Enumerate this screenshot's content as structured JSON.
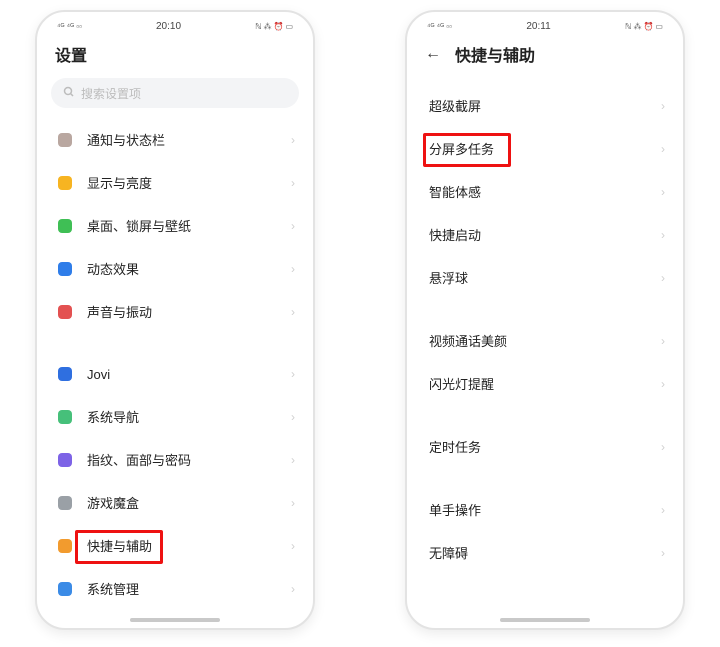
{
  "left": {
    "status": {
      "time": "20:10"
    },
    "title": "设置",
    "search_placeholder": "搜索设置项",
    "groups": [
      [
        {
          "icon": "bell-icon",
          "color": "#b9a7a0",
          "label": "通知与状态栏"
        },
        {
          "icon": "sun-icon",
          "color": "#f7b421",
          "label": "显示与亮度"
        },
        {
          "icon": "wallpaper-icon",
          "color": "#3fbf55",
          "label": "桌面、锁屏与壁纸"
        },
        {
          "icon": "motion-icon",
          "color": "#2f7de9",
          "label": "动态效果"
        },
        {
          "icon": "sound-icon",
          "color": "#e35151",
          "label": "声音与振动"
        }
      ],
      [
        {
          "icon": "jovi-icon",
          "color": "#2f6fe0",
          "label": "Jovi"
        },
        {
          "icon": "nav-icon",
          "color": "#46c07a",
          "label": "系统导航"
        },
        {
          "icon": "fingerprint-icon",
          "color": "#7d63e6",
          "label": "指纹、面部与密码"
        },
        {
          "icon": "gamebox-icon",
          "color": "#9aa0a6",
          "label": "游戏魔盒"
        },
        {
          "icon": "shortcut-icon",
          "color": "#f29b2e",
          "label": "快捷与辅助",
          "highlight": true
        },
        {
          "icon": "gear-icon",
          "color": "#3b8be6",
          "label": "系统管理"
        }
      ]
    ]
  },
  "right": {
    "status": {
      "time": "20:11"
    },
    "title": "快捷与辅助",
    "groups": [
      [
        {
          "label": "超级截屏"
        },
        {
          "label": "分屏多任务",
          "highlight": true
        },
        {
          "label": "智能体感"
        },
        {
          "label": "快捷启动"
        },
        {
          "label": "悬浮球"
        }
      ],
      [
        {
          "label": "视频通话美颜"
        },
        {
          "label": "闪光灯提醒"
        }
      ],
      [
        {
          "label": "定时任务"
        }
      ],
      [
        {
          "label": "单手操作"
        },
        {
          "label": "无障碍"
        }
      ]
    ]
  }
}
